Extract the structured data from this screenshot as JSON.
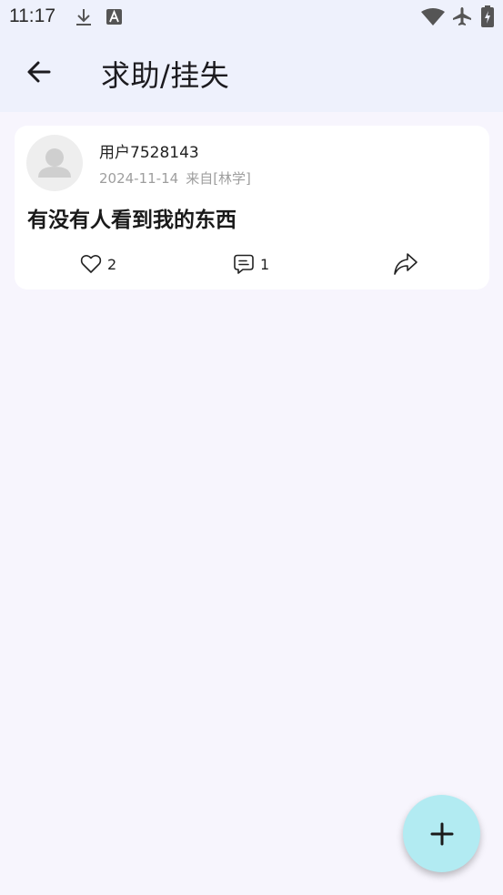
{
  "status_bar": {
    "time": "11:17",
    "left_icons": [
      "download-icon",
      "text-a-icon"
    ],
    "right_icons": [
      "wifi-icon",
      "airplane-icon",
      "battery-icon"
    ]
  },
  "app_bar": {
    "title": "求助/挂失",
    "back_icon": "arrow-left-icon",
    "background": "#eef1fc"
  },
  "posts": [
    {
      "username": "用户7528143",
      "date": "2024-11-14",
      "source": "来自[林学]",
      "title": "有没有人看到我的东西",
      "likes": "2",
      "comments": "1"
    }
  ],
  "fab": {
    "icon": "plus-icon",
    "color": "#b2ebf2"
  }
}
